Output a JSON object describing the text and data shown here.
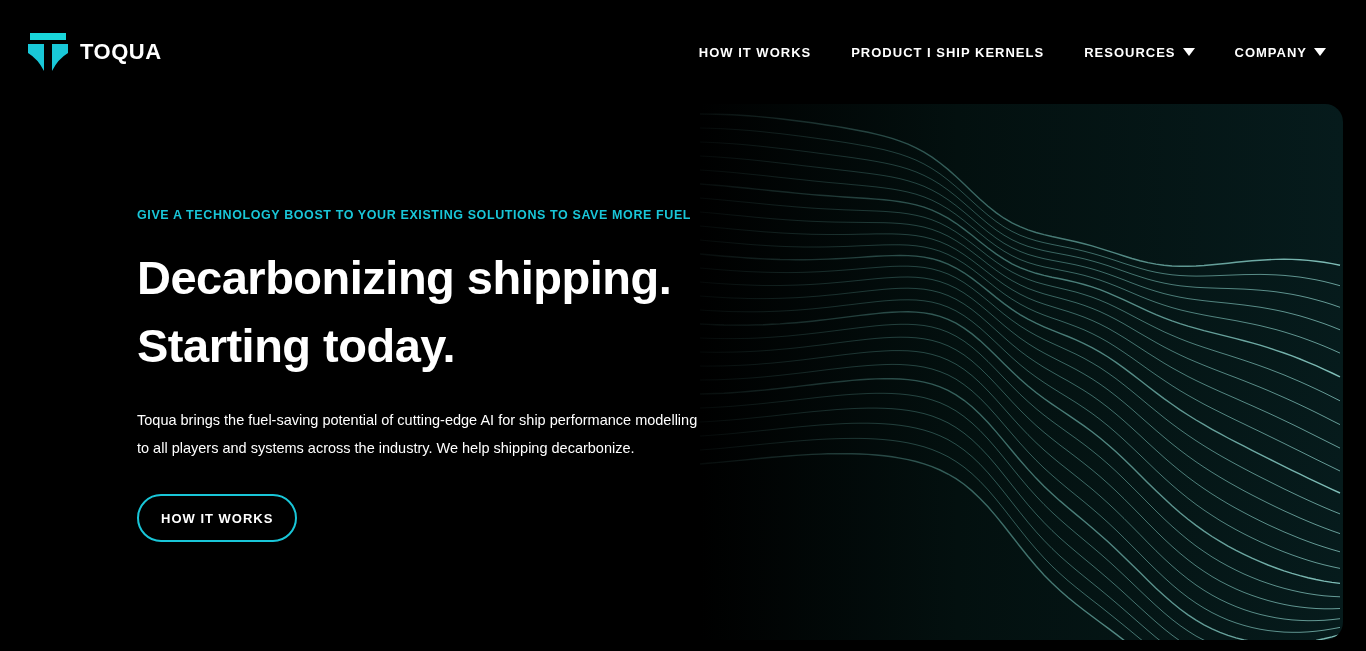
{
  "brand": {
    "name": "TOQUA"
  },
  "nav": [
    {
      "label": "HOW IT WORKS",
      "has_menu": false
    },
    {
      "label": "PRODUCT I SHIP KERNELS",
      "has_menu": false
    },
    {
      "label": "RESOURCES",
      "has_menu": true
    },
    {
      "label": "COMPANY",
      "has_menu": true
    }
  ],
  "hero": {
    "eyebrow": "GIVE A TECHNOLOGY BOOST TO YOUR EXISTING SOLUTIONS TO SAVE MORE FUEL",
    "heading_lines": [
      "Decarbonizing shipping.",
      "Starting today."
    ],
    "body": "Toqua brings the fuel-saving potential of cutting-edge AI for ship performance modelling to all players and systems across the industry. We help shipping decarbonize.",
    "button": "HOW IT WORKS"
  }
}
